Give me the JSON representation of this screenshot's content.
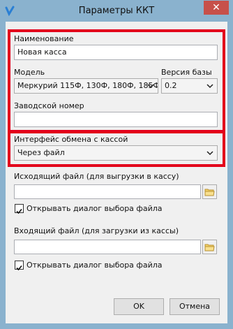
{
  "window": {
    "title": "Параметры ККТ",
    "close_glyph": "✕",
    "accent_color": "#8ab2ce",
    "highlight_color": "#e3001b"
  },
  "name_field": {
    "label": "Наименование",
    "value": "Новая касса"
  },
  "model": {
    "label": "Модель",
    "selected": "Меркурий 115Ф, 130Ф, 180Ф, 185Ф"
  },
  "base_version": {
    "label": "Версия базы",
    "selected": "0.2"
  },
  "serial_field": {
    "label": "Заводской номер",
    "value": ""
  },
  "interface": {
    "label": "Интерфейс обмена с кассой",
    "selected": "Через файл"
  },
  "outgoing": {
    "label": "Исходящий файл (для выгрузки в кассу)",
    "value": "",
    "checkbox_label": "Открывать диалог выбора файла",
    "checked": true
  },
  "incoming": {
    "label": "Входящий файл (для загрузки из кассы)",
    "value": "",
    "checkbox_label": "Открывать диалог выбора файла",
    "checked": true
  },
  "buttons": {
    "ok": "OK",
    "cancel": "Отмена"
  }
}
